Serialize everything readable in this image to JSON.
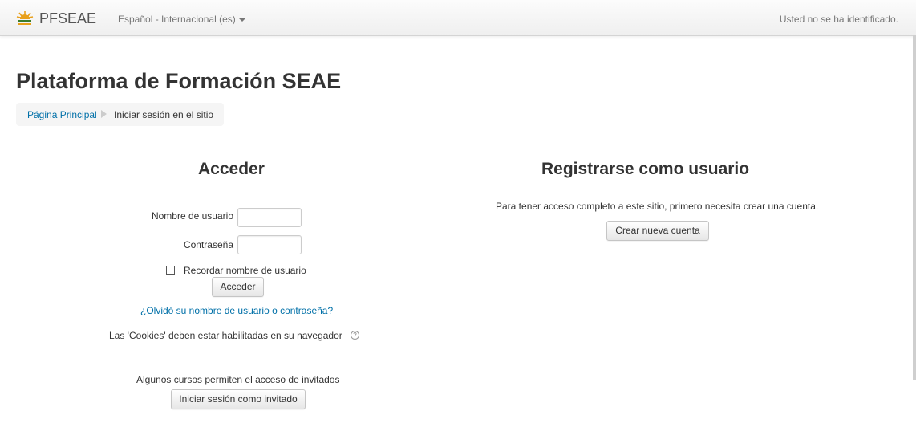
{
  "navbar": {
    "site_name": "PFSEAE",
    "language": "Español - Internacional (es)",
    "login_status": "Usted no se ha identificado."
  },
  "page": {
    "title": "Plataforma de Formación SEAE"
  },
  "breadcrumb": {
    "home": "Página Principal",
    "current": "Iniciar sesión en el sitio"
  },
  "login": {
    "heading": "Acceder",
    "username_label": "Nombre de usuario",
    "username_value": "",
    "password_label": "Contraseña",
    "password_value": "",
    "remember_label": "Recordar nombre de usuario",
    "remember_checked": false,
    "submit_label": "Acceder",
    "forgot_link": "¿Olvidó su nombre de usuario o contraseña?",
    "cookies_notice": "Las 'Cookies' deben estar habilitadas en su navegador",
    "help_icon": "question-circle-icon",
    "guest_notice": "Algunos cursos permiten el acceso de invitados",
    "guest_button": "Iniciar sesión como invitado"
  },
  "signup": {
    "heading": "Registrarse como usuario",
    "description": "Para tener acceso completo a este sitio, primero necesita crear una cuenta.",
    "create_button": "Crear nueva cuenta"
  },
  "colors": {
    "link": "#0070a8",
    "text": "#333333",
    "navbar_text": "#777777",
    "logo_primary": "#e8a01c"
  }
}
